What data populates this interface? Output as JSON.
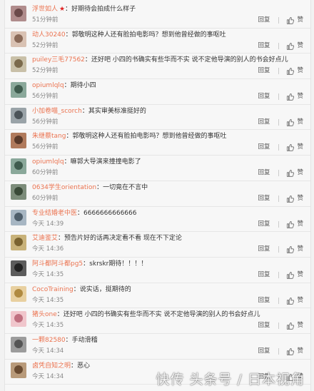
{
  "comments": [
    {
      "user": "浮世如人",
      "star": "★",
      "text": "好期待会拍成什么样子",
      "time": "51分钟前",
      "reply": "回复",
      "like": "赞",
      "avatar": [
        "#b08c8c",
        "#6b4a4a"
      ]
    },
    {
      "user": "动人30240",
      "text": "郭敬明这种人还有脸拍电影吗？想到他曾经做的事呕吐",
      "time": "52分钟前",
      "reply": "回复",
      "like": "赞",
      "avatar": [
        "#d9c2b3",
        "#8a6a58"
      ]
    },
    {
      "user": "puiley三毛77562",
      "text": "还好吧 小四的书确实有些华而不实 说不定他导演的别人的书会好点儿",
      "time": "52分钟前",
      "reply": "回复",
      "like": "赞",
      "avatar": [
        "#c9c0a8",
        "#7b6a4c"
      ]
    },
    {
      "user": "opiumlqlq",
      "text": "期待小四",
      "time": "56分钟前",
      "reply": "回复",
      "like": "赞",
      "avatar": [
        "#8aa89a",
        "#3f5c4e"
      ]
    },
    {
      "user": "小加卷喵_scorch",
      "text": "其实审美标准挺好的",
      "time": "56分钟前",
      "reply": "回复",
      "like": "赞",
      "avatar": [
        "#9aa3a8",
        "#4c5459"
      ]
    },
    {
      "user": "朱继蔡tang",
      "text": "郭敬明这种人还有脸拍电影吗？想到他曾经做的事呕吐",
      "time": "56分钟前",
      "reply": "回复",
      "like": "赞",
      "avatar": [
        "#b07a5c",
        "#5a3a2a"
      ]
    },
    {
      "user": "opiumlqlq",
      "text": "嘛郭大导演来撞撞电影了",
      "time": "60分钟前",
      "reply": "回复",
      "like": "赞",
      "avatar": [
        "#8aa89a",
        "#3f5c4e"
      ]
    },
    {
      "user": "0634学生orientation",
      "text": "一切竟在不言中",
      "time": "60分钟前",
      "reply": "回复",
      "like": "赞",
      "avatar": [
        "#7c8c7a",
        "#3a4a38"
      ]
    },
    {
      "user": "专业结婚老中医",
      "text": "6666666666666",
      "time": "今天 14:39",
      "reply": "回复",
      "like": "赞",
      "avatar": [
        "#a7b6c3",
        "#4e5e6b"
      ]
    },
    {
      "user": "艾迪鉴艾",
      "text": "预告片好的话再决定看不看 现在不下定论",
      "time": "今天 14:36",
      "reply": "回复",
      "like": "赞",
      "avatar": [
        "#c8b27a",
        "#7a6330"
      ]
    },
    {
      "user": "阿斗都阿斗都pg5",
      "text": "skrskr期待！！！！",
      "time": "今天 14:35",
      "reply": "回复",
      "like": "赞",
      "avatar": [
        "#5c5c5c",
        "#222222"
      ]
    },
    {
      "user": "CocoTraining",
      "text": "说实话，挺期待的",
      "time": "今天 14:35",
      "reply": "回复",
      "like": "赞",
      "avatar": [
        "#e8d0a0",
        "#b08a40"
      ]
    },
    {
      "user": "猪头one",
      "text": "还好吧 小四的书确实有些华而不实 说不定他导演的别人的书会好点儿",
      "time": "今天 14:35",
      "reply": "回复",
      "like": "赞",
      "avatar": [
        "#f0c6cc",
        "#c07080"
      ]
    },
    {
      "user": "一颗82580",
      "text": "手动滑稽",
      "time": "今天 14:34",
      "reply": "回复",
      "like": "赞",
      "avatar": [
        "#9c9c9c",
        "#555555"
      ]
    },
    {
      "user": "卤凭自知之明",
      "text": "恶心",
      "time": "今天 14:34",
      "reply": "回复",
      "like": "赞",
      "avatar": [
        "#b89a7a",
        "#6a4c32"
      ]
    }
  ],
  "watermark": "快传 头条号 / 日本视角"
}
